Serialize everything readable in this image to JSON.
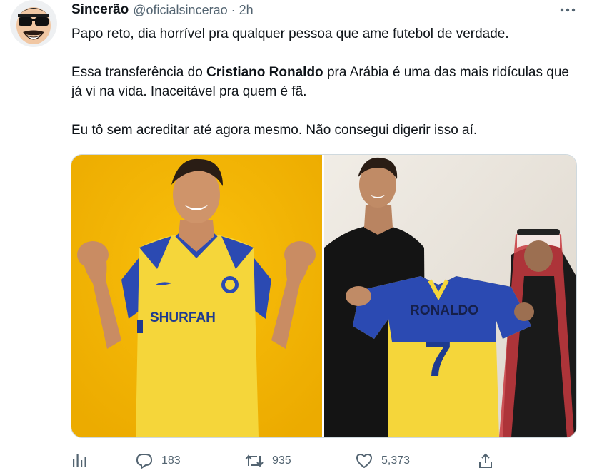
{
  "author": {
    "name": "Sincerão",
    "handle": "@oficialsincerao",
    "separator": "·",
    "time": "2h"
  },
  "tweet": {
    "line1": "Papo reto, dia horrível pra qualquer pessoa que ame futebol de verdade.",
    "p2_before": "Essa transferência do ",
    "p2_bold": "Cristiano Ronaldo",
    "p2_after": " pra Arábia é uma das mais ridículas que já vi na vida. Inaceitável pra quem é fã.",
    "line3": "Eu tô sem acreditar até agora mesmo. Não consegui digerir isso aí."
  },
  "media": {
    "left_photo": {
      "jersey_text": "SHURFAH"
    },
    "right_photo": {
      "jersey_name": "RONALDO",
      "jersey_number": "7"
    }
  },
  "actions": {
    "replies": "183",
    "retweets": "935",
    "likes": "5,373"
  },
  "colors": {
    "text": "#0f1419",
    "secondary": "#536471",
    "jersey_yellow": "#f5d63a",
    "jersey_blue": "#2b4ab2",
    "backdrop_yellow": "#f3b700"
  },
  "icons": [
    "more-icon",
    "analytics-icon",
    "reply-icon",
    "retweet-icon",
    "like-icon",
    "share-icon"
  ]
}
